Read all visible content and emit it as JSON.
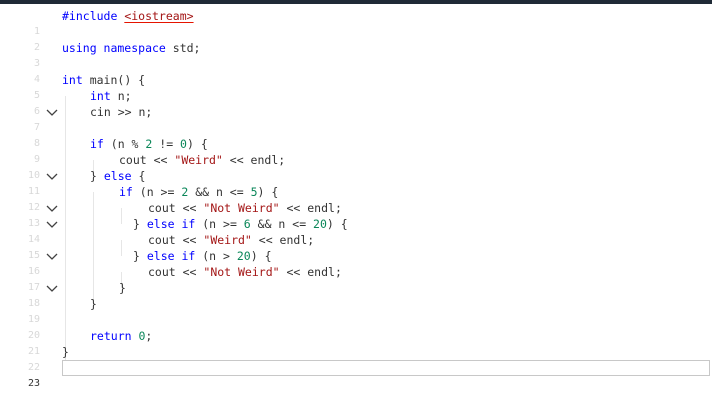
{
  "line_numbers": [
    "1",
    "2",
    "3",
    "4",
    "5",
    "6",
    "7",
    "8",
    "9",
    "10",
    "11",
    "12",
    "13",
    "14",
    "15",
    "16",
    "17",
    "18",
    "19",
    "20",
    "21",
    "22",
    "23"
  ],
  "code": {
    "l1_include": "#include ",
    "l1_header": "<iostream>",
    "l3_using": "using namespace",
    "l3_rest": " std;",
    "l5_int": "int",
    "l5_rest": " main() {",
    "l6_int": "int",
    "l6_rest": " n;",
    "l7": "cin >> n;",
    "l9_if": "if",
    "l9_a": " (n % ",
    "l9_2": "2",
    "l9_b": " != ",
    "l9_0": "0",
    "l9_c": ") {",
    "l10_a": "cout << ",
    "l10_str": "\"Weird\"",
    "l10_b": " << endl;",
    "l11_a": "} ",
    "l11_else": "else",
    "l11_b": " {",
    "l12_if": "if",
    "l12_a": " (n >= ",
    "l12_2": "2",
    "l12_b": " && n <= ",
    "l12_5": "5",
    "l12_c": ") {",
    "l13_a": "cout << ",
    "l13_str": "\"Not Weird\"",
    "l13_b": " << endl;",
    "l14_a": "} ",
    "l14_elseif": "else if",
    "l14_b": " (n >= ",
    "l14_6": "6",
    "l14_c": " && n <= ",
    "l14_20": "20",
    "l14_d": ") {",
    "l15_a": "cout << ",
    "l15_str": "\"Weird\"",
    "l15_b": " << endl;",
    "l16_a": "} ",
    "l16_elseif": "else if",
    "l16_b": " (n > ",
    "l16_20": "20",
    "l16_c": ") {",
    "l17_a": "cout << ",
    "l17_str": "\"Not Weird\"",
    "l17_b": " << endl;",
    "l18": "}",
    "l19": "}",
    "l21_return": "return",
    "l21_sp": " ",
    "l21_0": "0",
    "l21_semi": ";",
    "l22": "}"
  },
  "fold_icon": "chevron-down-icon",
  "active_line": "23",
  "colors": {
    "keyword": "#0000ff",
    "string": "#a31515",
    "number": "#098658",
    "text": "#333333",
    "line_number": "#d8d8d8"
  }
}
